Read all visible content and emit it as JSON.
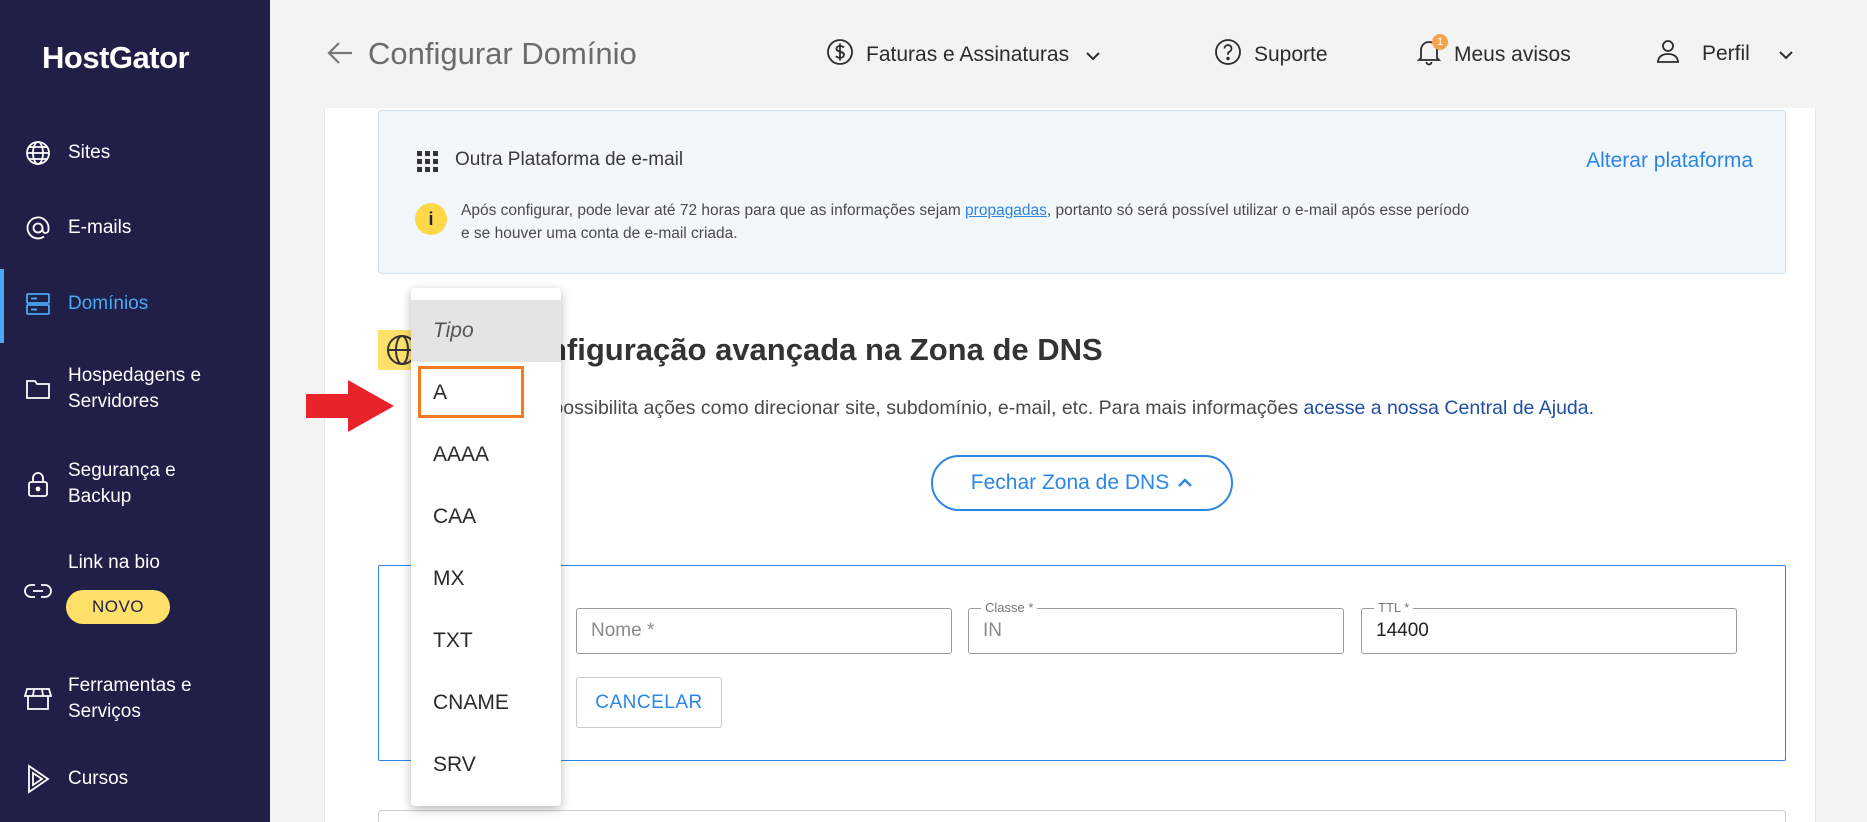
{
  "sidebar": {
    "logo": "HostGator",
    "items": [
      {
        "label": "Sites"
      },
      {
        "label": "E-mails"
      },
      {
        "label": "Domínios"
      },
      {
        "label": "Hospedagens e",
        "label2": "Servidores"
      },
      {
        "label": "Segurança e",
        "label2": "Backup"
      },
      {
        "label": "Link na bio"
      },
      {
        "label": "Ferramentas e",
        "label2": "Serviços"
      },
      {
        "label": "Cursos"
      }
    ],
    "novo_badge": "NOVO",
    "active_color": "#4aa9f5",
    "bg_color": "#1f1f48"
  },
  "header": {
    "title": "Configurar Domínio",
    "invoices": "Faturas e Assinaturas",
    "support": "Suporte",
    "notices": "Meus avisos",
    "notices_count": "1",
    "profile": "Perfil"
  },
  "email_platform": {
    "title": "Outra Plataforma de e-mail",
    "change_link": "Alterar plataforma",
    "info_before": "Após configurar, pode levar até 72 horas para que as informações sejam ",
    "info_link": "propagadas",
    "info_after": ", portanto só será possível utilizar o e-mail após esse período",
    "info_line2": "e se houver uma conta de e-mail criada."
  },
  "dns": {
    "title": "nfiguração avançada na Zona de DNS",
    "desc": "S possibilita ações como direcionar site, subdomínio, e-mail, etc. Para mais informações ",
    "desc_link": "acesse a nossa Central de Ajuda.",
    "close_button": "Fechar Zona de DNS"
  },
  "form": {
    "name_placeholder": "Nome *",
    "class_label": "Classe *",
    "class_value": "IN",
    "ttl_label": "TTL *",
    "ttl_value": "14400",
    "cancel_button": "CANCELAR"
  },
  "type_dropdown": {
    "header": "Tipo",
    "options": [
      "A",
      "AAAA",
      "CAA",
      "MX",
      "TXT",
      "CNAME",
      "SRV"
    ],
    "highlighted": "A",
    "highlight_color": "#f37a20"
  },
  "colors": {
    "accent": "#2b86e6",
    "warning": "#ffd84a",
    "arrow": "#e8242a"
  }
}
